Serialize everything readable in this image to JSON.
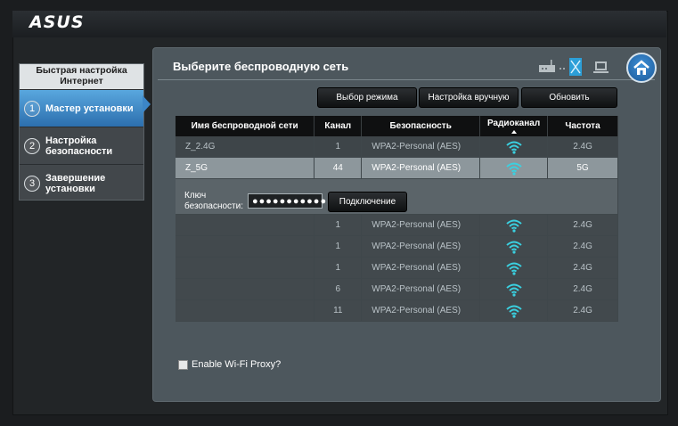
{
  "brand": "ASUS",
  "sidebar": {
    "title": "Быстрая настройка Интернет",
    "items": [
      {
        "num": "1",
        "label": "Мастер установки",
        "active": true
      },
      {
        "num": "2",
        "label": "Настройка безопасности",
        "active": false
      },
      {
        "num": "3",
        "label": "Завершение установки",
        "active": false
      }
    ]
  },
  "panel": {
    "title": "Выберите беспроводную сеть",
    "buttons": {
      "mode": "Выбор режима",
      "manual": "Настройка вручную",
      "refresh": "Обновить"
    }
  },
  "table": {
    "headers": [
      "Имя беспроводной сети",
      "Канал",
      "Безопасность",
      "Радиоканал",
      "Частота"
    ],
    "rows": [
      {
        "ssid": "Z_2.4G",
        "channel": "1",
        "security": "WPA2-Personal (AES)",
        "band": "2.4G",
        "signal_color": "#3ad0e0"
      },
      {
        "ssid": "Z_5G",
        "channel": "44",
        "security": "WPA2-Personal (AES)",
        "band": "5G",
        "signal_color": "#3ad0e0"
      },
      {
        "ssid": "",
        "channel": "1",
        "security": "WPA2-Personal (AES)",
        "band": "2.4G",
        "signal_color": "#3ad0e0"
      },
      {
        "ssid": "",
        "channel": "1",
        "security": "WPA2-Personal (AES)",
        "band": "2.4G",
        "signal_color": "#3ad0e0"
      },
      {
        "ssid": "",
        "channel": "1",
        "security": "WPA2-Personal (AES)",
        "band": "2.4G",
        "signal_color": "#3ad0e0"
      },
      {
        "ssid": "",
        "channel": "6",
        "security": "WPA2-Personal (AES)",
        "band": "2.4G",
        "signal_color": "#3ad0e0"
      },
      {
        "ssid": "",
        "channel": "11",
        "security": "WPA2-Personal (AES)",
        "band": "2.4G",
        "signal_color": "#3ad0e0"
      }
    ]
  },
  "key": {
    "label": "Ключ безопасности:",
    "value": "●●●●●●●●●●●",
    "connect_label": "Подключение"
  },
  "proxy": {
    "label": "Enable Wi-Fi Proxy?",
    "checked": false
  },
  "colors": {
    "accent": "#3c86c7",
    "signal": "#3ad0e0"
  }
}
